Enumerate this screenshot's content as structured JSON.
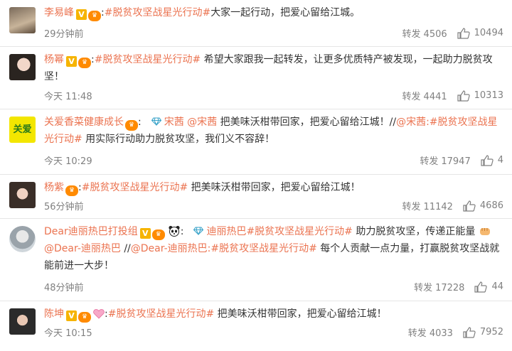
{
  "posts": [
    {
      "user": "李易峰",
      "topic": "#脱贫攻坚战星光行动#",
      "text": "大家一起行动，把爱心留给江城。",
      "time": "29分钟前",
      "repost_label": "转发",
      "reposts": "4506",
      "likes": "10494"
    },
    {
      "user": "杨幂",
      "topic": "#脱贫攻坚战星光行动#",
      "text": " 希望大家跟我一起转发，让更多优质特产被发现，一起助力脱贫攻坚！",
      "time": "今天 11:48",
      "repost_label": "转发",
      "reposts": "4441",
      "likes": "10313"
    },
    {
      "user": "关爱香菜健康成长",
      "mention1": "宋茜",
      "mention2": "@宋茜",
      "text1": " 把美味沃柑带回家，把爱心留给江城！//",
      "mention3": "@宋茜",
      "topic": ":#脱贫攻坚战星光行动#",
      "text2": " 用实际行动助力脱贫攻坚，我们义不容辞！",
      "time": "今天 10:29",
      "repost_label": "转发",
      "reposts": "17947",
      "likes": "4"
    },
    {
      "user": "杨紫",
      "topic": "#脱贫攻坚战星光行动#",
      "text": " 把美味沃柑带回家，把爱心留给江城！",
      "time": "56分钟前",
      "repost_label": "转发",
      "reposts": "11142",
      "likes": "4686"
    },
    {
      "user": "Dear迪丽热巴打投组",
      "mention1": "迪丽热巴",
      "topic1": "#脱贫攻坚战星光行动#",
      "text1": " 助力脱贫攻坚，传递正能量 ",
      "mention2": "@Dear-迪丽热巴",
      "sep": " //",
      "mention3": "@Dear-迪丽热巴",
      "topic2": ":#脱贫攻坚战星光行动#",
      "text2": " 每个人贡献一点力量，打赢脱贫攻坚战就能前进一大步！",
      "time": "48分钟前",
      "repost_label": "转发",
      "reposts": "17228",
      "likes": "44"
    },
    {
      "user": "陈坤",
      "topic": "#脱贫攻坚战星光行动#",
      "text": " 把美味沃柑带回家，把爱心留给江城！",
      "time": "今天 10:15",
      "repost_label": "转发",
      "reposts": "4033",
      "likes": "7952"
    }
  ],
  "colors": {
    "accent": "#eb7350",
    "meta": "#808080",
    "text": "#333333"
  },
  "icons": [
    "verified-v-icon",
    "vip-crown-icon",
    "like-thumb-icon",
    "diamond-icon",
    "panda-icon",
    "heart-icon",
    "fist-icon"
  ]
}
